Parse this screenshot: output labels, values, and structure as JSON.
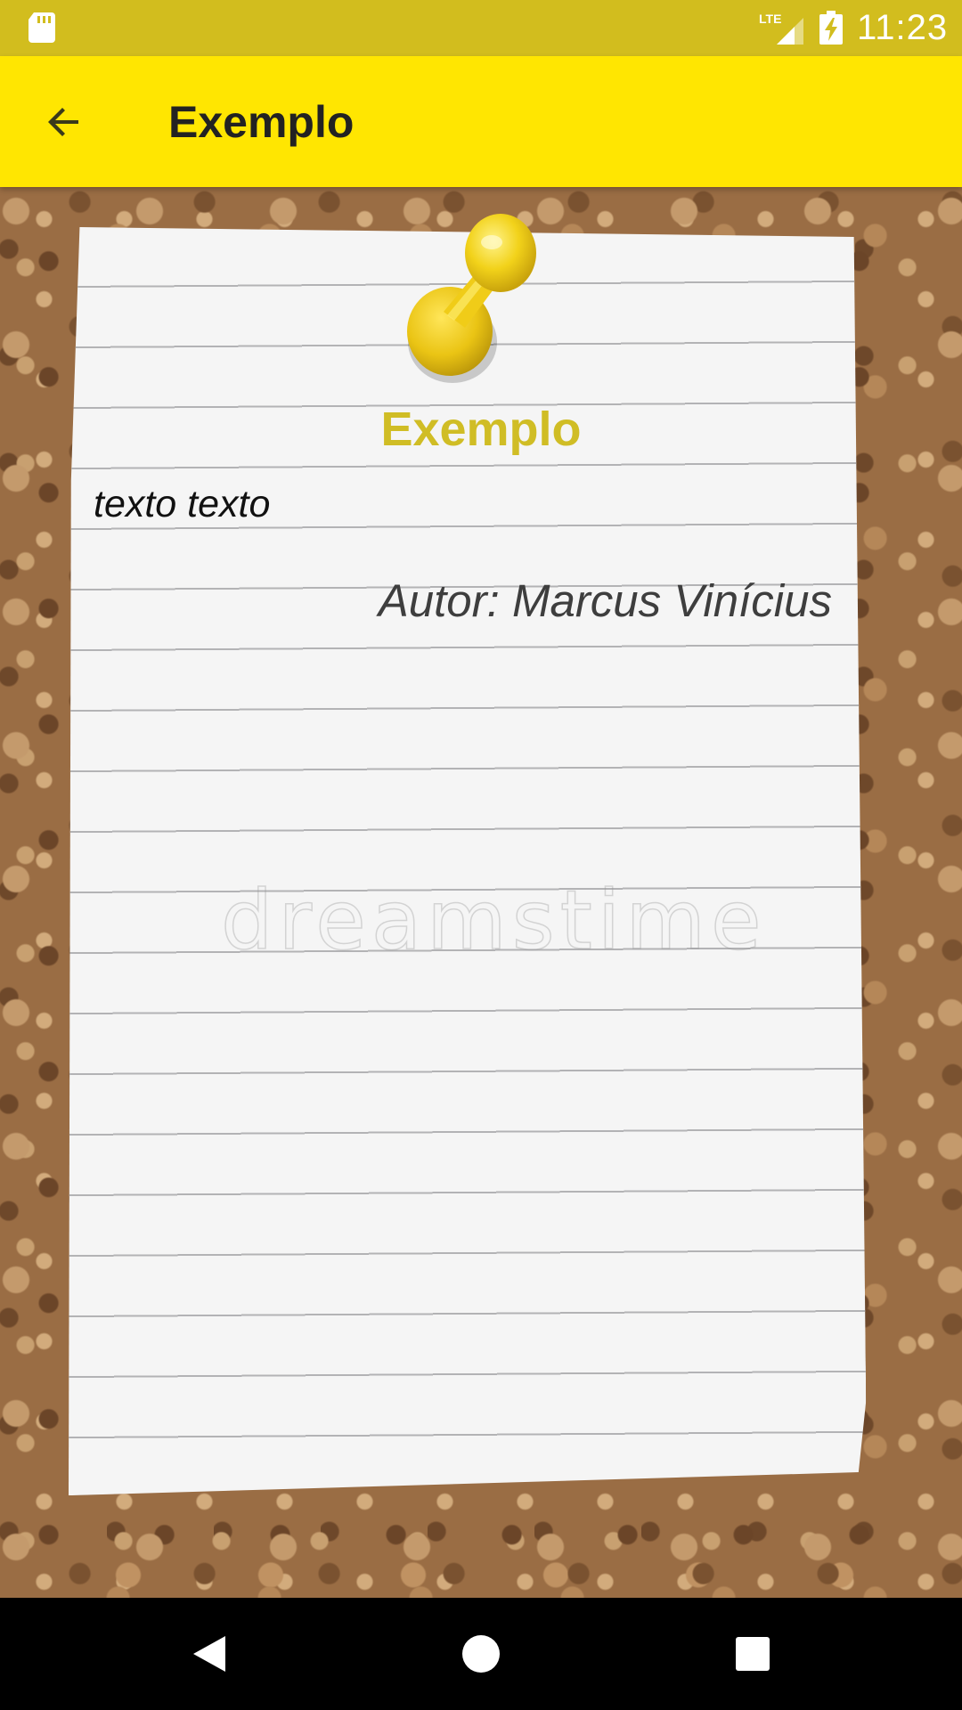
{
  "status_bar": {
    "time": "11:23",
    "network_label": "LTE",
    "background_color": "#d2bd1e",
    "icons": [
      "sd-card-icon",
      "lte-signal-icon",
      "battery-charging-icon"
    ]
  },
  "app_bar": {
    "title": "Exemplo",
    "back_icon": "arrow-back-icon",
    "background_color": "#ffe601"
  },
  "note": {
    "title": "Exemplo",
    "body": "texto texto",
    "author": "Autor: Marcus Vinícius",
    "title_color": "#d0bd25"
  },
  "background": {
    "watermark": "dreamstime",
    "pin_icon": "pushpin-icon"
  },
  "nav_bar": {
    "icons": [
      "nav-back-icon",
      "nav-home-icon",
      "nav-recents-icon"
    ]
  }
}
